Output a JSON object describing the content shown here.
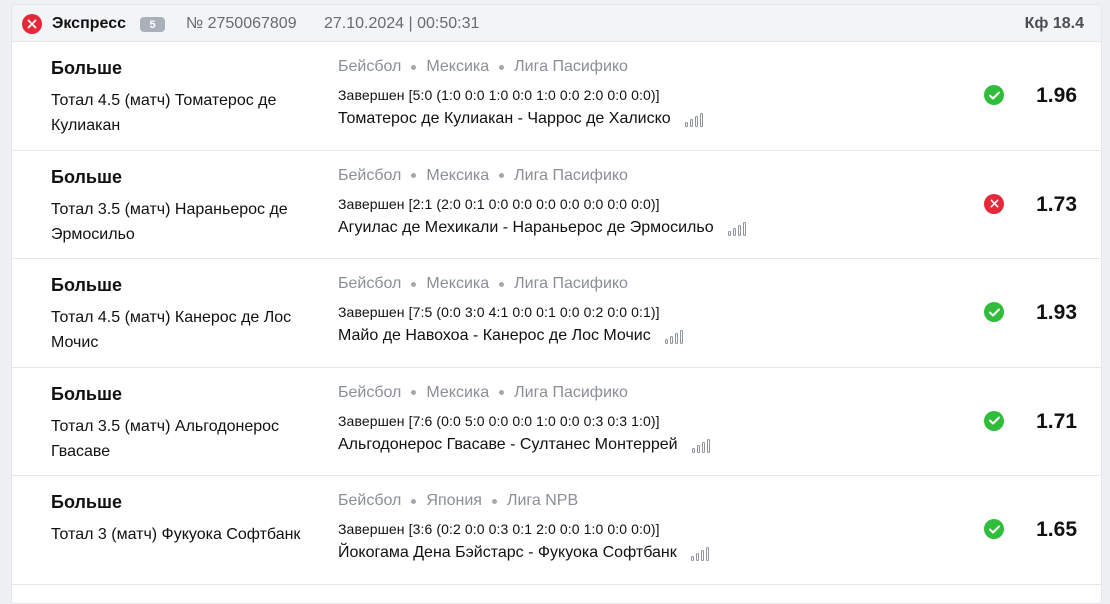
{
  "header": {
    "title": "Экспресс",
    "count": "5",
    "ticket_number": "№ 2750067809",
    "datetime": "27.10.2024 | 00:50:31",
    "total_kf": "Кф 18.4",
    "status_icon": "close-icon",
    "status_color": "#e5283a"
  },
  "bets": [
    {
      "bet_type": "Больше",
      "market": "Тотал 4.5 (матч) Томатерос де Кулиакан",
      "sport": "Бейсбол",
      "country": "Мексика",
      "league": "Лига Пасифико",
      "result": "Завершен [5:0 (1:0 0:0 1:0 0:0 1:0 0:0 2:0 0:0 0:0)]",
      "teams": "Томатерос де Кулиакан - Чаррос де Халиско",
      "outcome": "win",
      "odd": "1.96"
    },
    {
      "bet_type": "Больше",
      "market": "Тотал 3.5 (матч) Нараньерос де Эрмосильо",
      "sport": "Бейсбол",
      "country": "Мексика",
      "league": "Лига Пасифико",
      "result": "Завершен [2:1 (2:0 0:1 0:0 0:0 0:0 0:0 0:0 0:0 0:0)]",
      "teams": "Агуилас де Мехикали - Нараньерос де Эрмосильо",
      "outcome": "lose",
      "odd": "1.73"
    },
    {
      "bet_type": "Больше",
      "market": "Тотал 4.5 (матч) Канерос де Лос Мочис",
      "sport": "Бейсбол",
      "country": "Мексика",
      "league": "Лига Пасифико",
      "result": "Завершен [7:5 (0:0 3:0 4:1 0:0 0:1 0:0 0:2 0:0 0:1)]",
      "teams": "Майо де Навохоа - Канерос де Лос Мочис",
      "outcome": "win",
      "odd": "1.93"
    },
    {
      "bet_type": "Больше",
      "market": "Тотал 3.5 (матч) Альгодонерос Гвасаве",
      "sport": "Бейсбол",
      "country": "Мексика",
      "league": "Лига Пасифико",
      "result": "Завершен [7:6 (0:0 5:0 0:0 0:0 1:0 0:0 0:3 0:3 1:0)]",
      "teams": "Альгодонерос Гвасаве - Султанес Монтеррей",
      "outcome": "win",
      "odd": "1.71"
    },
    {
      "bet_type": "Больше",
      "market": "Тотал 3 (матч) Фукуока Софтбанк",
      "sport": "Бейсбол",
      "country": "Япония",
      "league": "Лига NPB",
      "result": "Завершен [3:6 (0:2 0:0 0:3 0:1 2:0 0:0 1:0 0:0 0:0)]",
      "teams": "Йокогама Дена Бэйстарс - Фукуока Софтбанк",
      "outcome": "win",
      "odd": "1.65"
    }
  ]
}
